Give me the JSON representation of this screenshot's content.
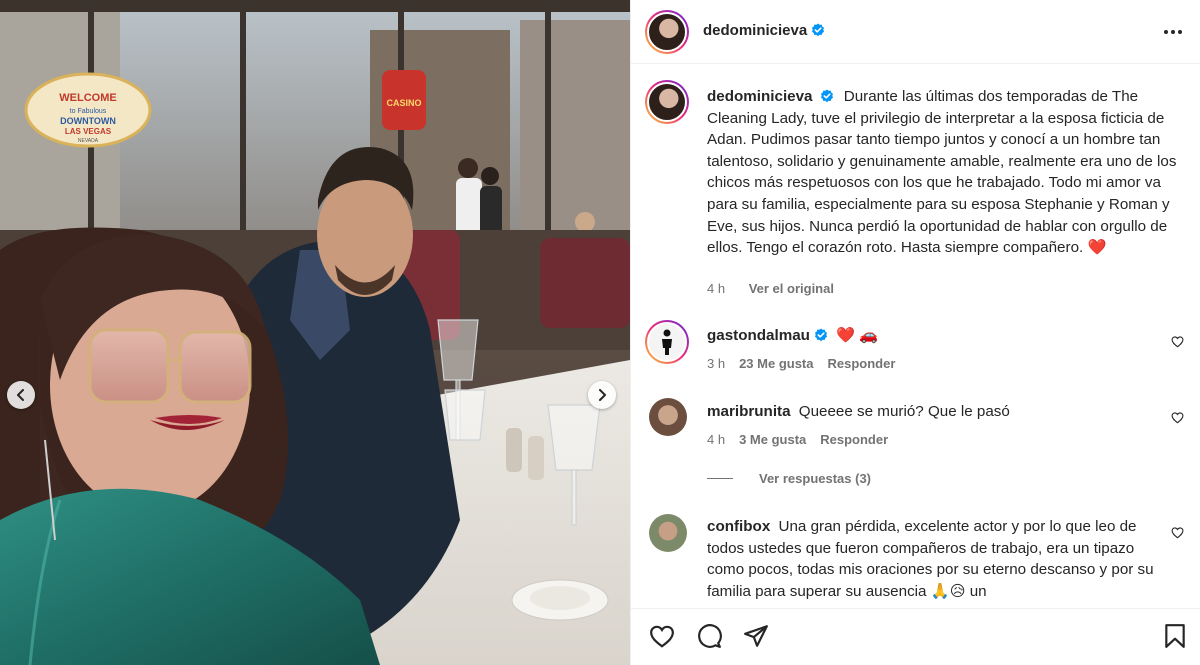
{
  "post": {
    "username": "dedominicieva",
    "caption": "Durante las últimas dos temporadas de The Cleaning Lady, tuve el privilegio de interpretar a la esposa ficticia de Adan. Pudimos pasar tanto tiempo juntos y conocí a un hombre tan talentoso, solidario y genuinamente amable, realmente era uno de los chicos más respetuosos con los que he trabajado. Todo mi amor va para su familia, especialmente para su esposa Stephanie y Roman y Eve, sus hijos. Nunca perdió la oportunidad de hablar con orgullo de ellos. Tengo el corazón roto. Hasta siempre compañero.",
    "caption_emoji": "❤️",
    "time": "4 h",
    "see_original": "Ver el original"
  },
  "photo_text": {
    "sign_welcome": "WELCOME",
    "sign_to": "to Fabulous",
    "sign_downtown": "DOWNTOWN",
    "sign_city": "LAS VEGAS",
    "sign_state": "NEVADA",
    "sign_casino": "CASINO"
  },
  "comments": [
    {
      "username": "gastondalmau",
      "verified": true,
      "text": "",
      "emoji": "❤️ 🚗",
      "time": "3 h",
      "likes": "23 Me gusta",
      "reply": "Responder"
    },
    {
      "username": "maribrunita",
      "verified": false,
      "text": "Queeee se murió? Que le pasó",
      "emoji": "",
      "time": "4 h",
      "likes": "3 Me gusta",
      "reply": "Responder"
    },
    {
      "username": "confibox",
      "verified": false,
      "text": "Una gran pérdida, excelente actor y por lo que leo de todos ustedes que fueron compañeros de trabajo, era un tipazo como pocos, todas mis oraciones por su eterno descanso y por su familia para superar su ausencia",
      "emoji": "🙏😥",
      "tail": "un"
    }
  ],
  "view_replies": "Ver respuestas (3)",
  "icons": {
    "verified": "verified-badge-icon",
    "more": "more-options-icon",
    "like": "heart-icon",
    "comment": "comment-icon",
    "share": "share-icon",
    "save": "bookmark-icon",
    "prev": "chevron-left-icon",
    "next": "chevron-right-icon"
  },
  "colors": {
    "verified": "#0095f6",
    "text": "#262626",
    "muted": "#737373",
    "heart": "#ed4956"
  }
}
